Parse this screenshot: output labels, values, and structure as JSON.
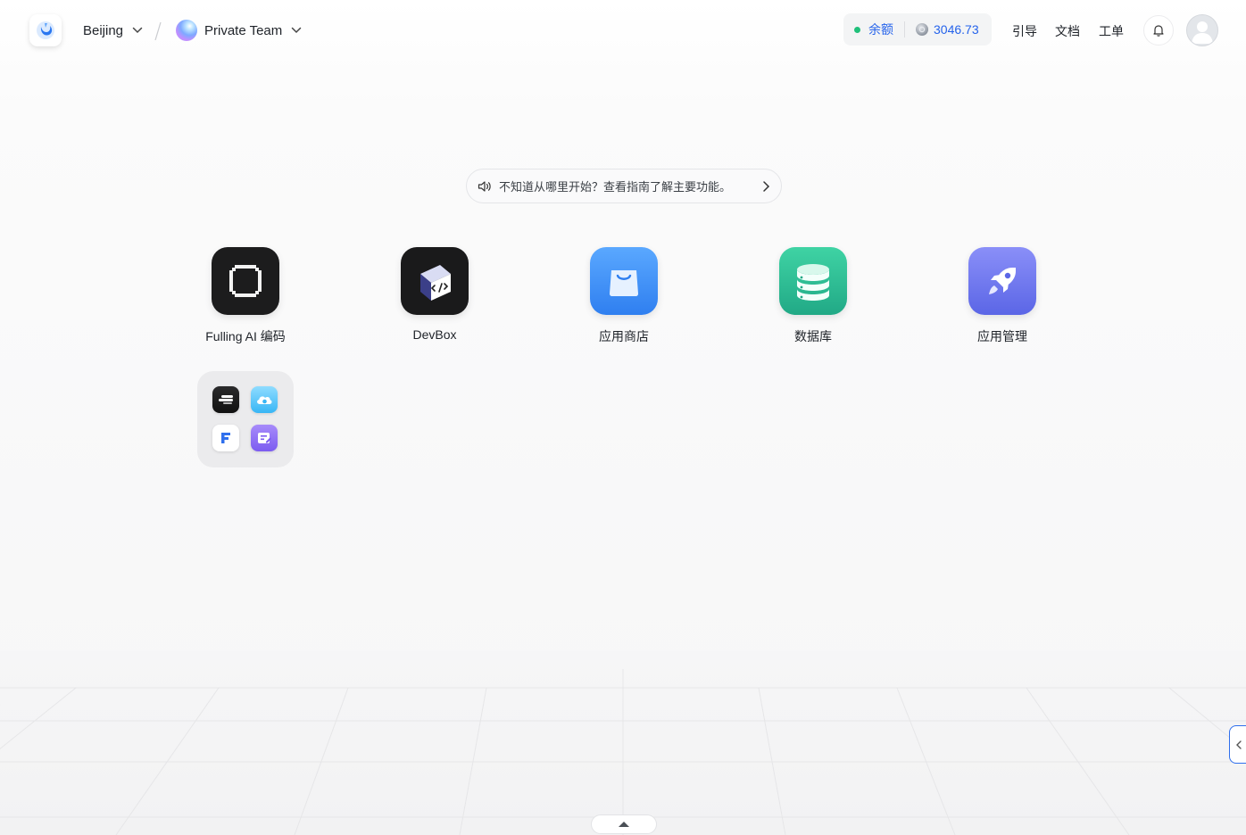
{
  "header": {
    "region": "Beijing",
    "team": "Private Team",
    "balance_label": "余额",
    "balance_value": "3046.73",
    "nav": [
      "引导",
      "文档",
      "工单"
    ]
  },
  "guide": {
    "text": "不知道从哪里开始？查看指南了解主要功能。"
  },
  "apps": [
    {
      "label": "Fulling AI 编码",
      "icon": "fulling-ai-icon"
    },
    {
      "label": "DevBox",
      "icon": "devbox-icon"
    },
    {
      "label": "应用商店",
      "icon": "app-store-icon"
    },
    {
      "label": "数据库",
      "icon": "database-icon"
    },
    {
      "label": "应用管理",
      "icon": "app-launchpad-icon"
    }
  ],
  "folder": {
    "icons": [
      "terminal-app-icon",
      "cloud-app-icon",
      "f-app-icon",
      "edit-app-icon"
    ]
  },
  "colors": {
    "accent": "#2563eb",
    "status_dot": "#20c07a",
    "app_store": "#3b8ef3",
    "database": "#30c39a",
    "app_launchpad": "#6d79ee"
  }
}
